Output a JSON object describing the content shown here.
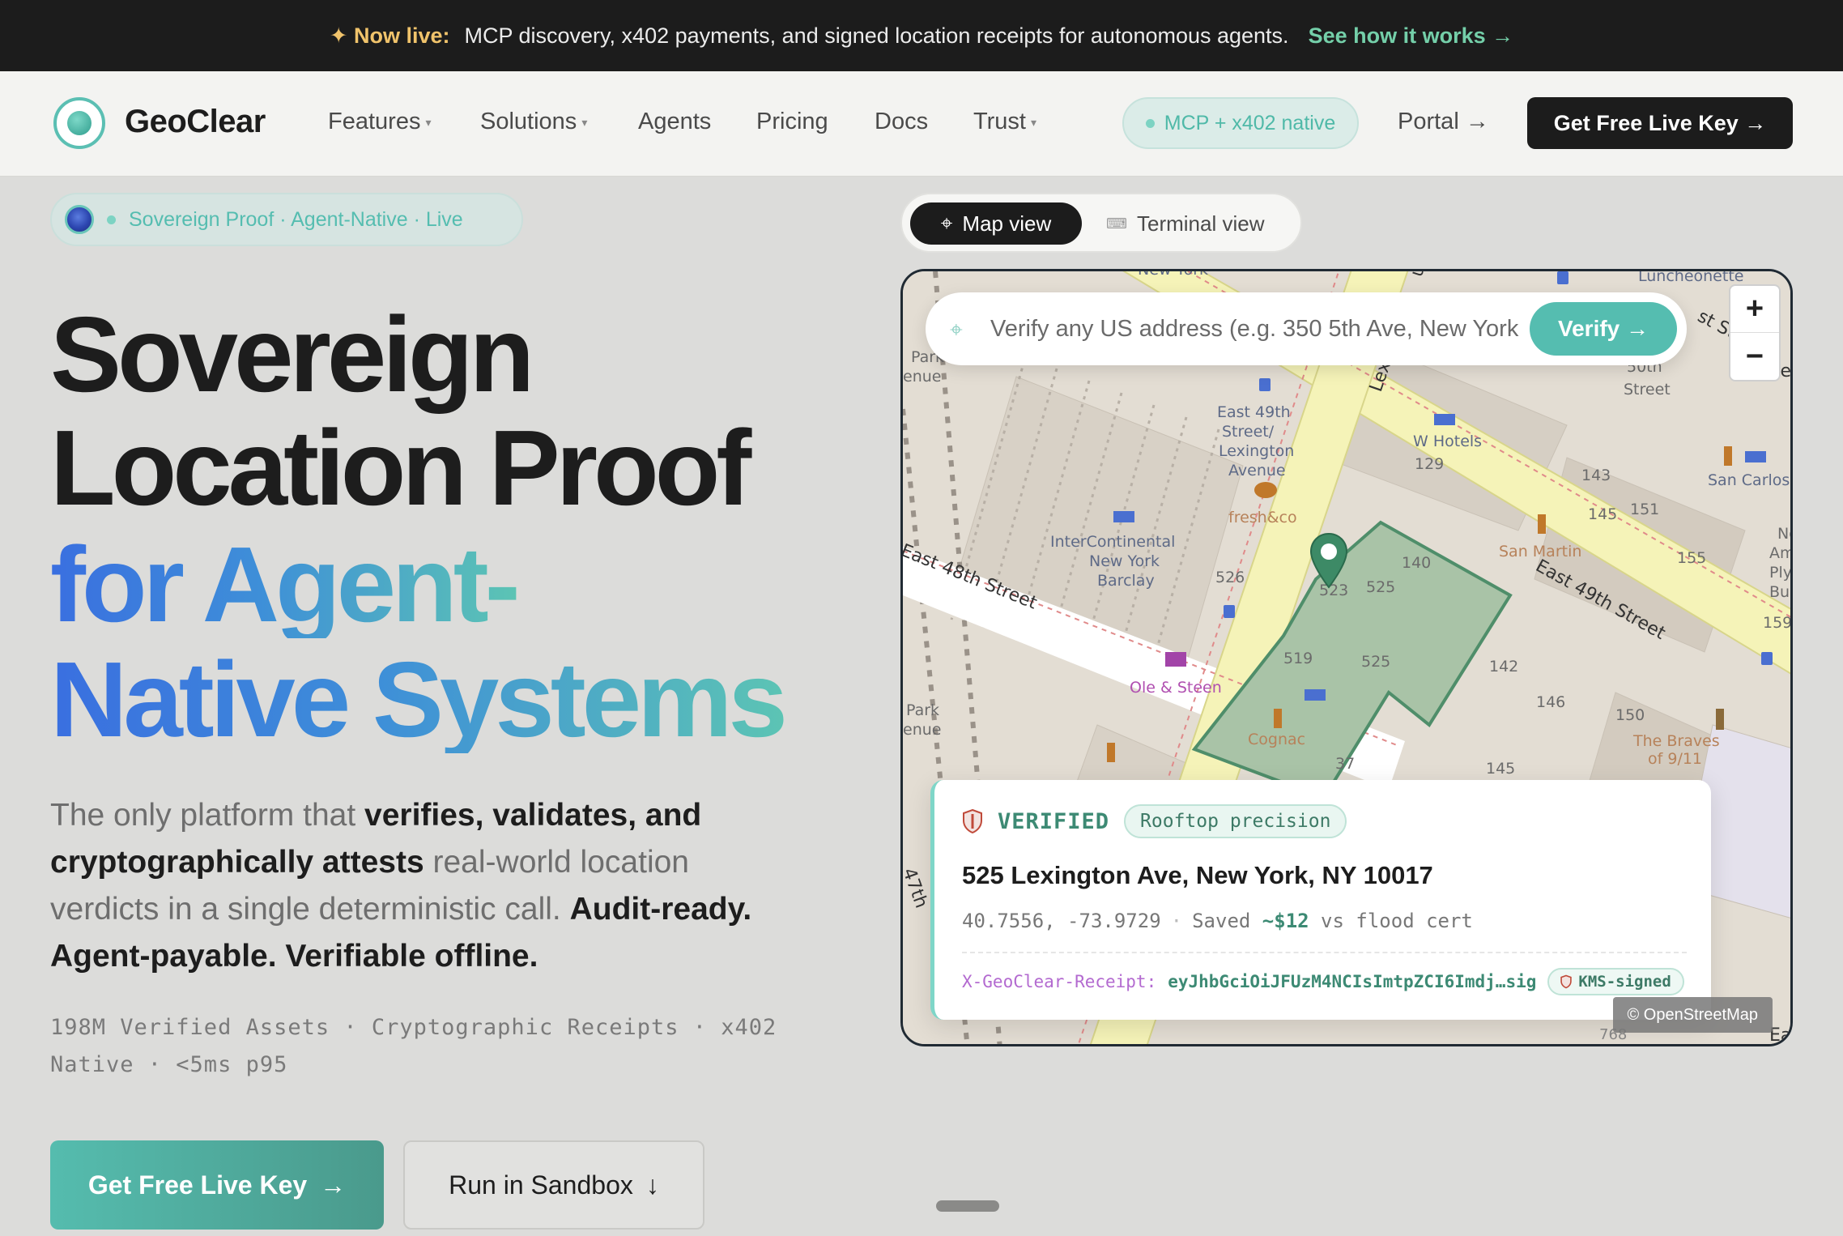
{
  "announcement": {
    "label": "✦ Now live:",
    "text": "MCP discovery, x402 payments, and signed location receipts for autonomous agents.",
    "link": "See how it works →"
  },
  "brand": {
    "name": "GeoClear",
    "accent": "#55bdb0",
    "dark": "#1c1c1c"
  },
  "nav": {
    "items": [
      {
        "label": "Features",
        "dropdown": true
      },
      {
        "label": "Solutions",
        "dropdown": true
      },
      {
        "label": "Agents",
        "dropdown": false
      },
      {
        "label": "Pricing",
        "dropdown": false
      },
      {
        "label": "Docs",
        "dropdown": false
      },
      {
        "label": "Trust",
        "dropdown": true
      }
    ],
    "caret": "▾",
    "native_pill": "MCP + x402 native",
    "portal": "Portal →",
    "cta": "Get Free Live Key →"
  },
  "hero": {
    "badge": "Sovereign Proof · Agent-Native · Live",
    "title_line1": "Sovereign",
    "title_line2": "Location Proof",
    "title_line3": "for Agent-",
    "title_line4": "Native Systems",
    "lead": {
      "p1": "The only platform that ",
      "b1": "verifies, validates, and cryptographically attests",
      "p2": " real-world location verdicts in a single deterministic call. ",
      "b2": "Audit-ready. Agent-payable. Verifiable offline."
    },
    "stats": "198M Verified Assets · Cryptographic Receipts · x402 Native · <5ms p95",
    "cta_primary": "Get Free Live Key",
    "cta_primary_arrow": "→",
    "cta_secondary": "Run in Sandbox",
    "cta_secondary_arrow": "↓"
  },
  "view_toggle": {
    "map_label": "Map view",
    "map_icon": "⌖",
    "terminal_label": "Terminal view",
    "terminal_icon": "⌨"
  },
  "map": {
    "search_placeholder": "Verify any US address (e.g. 350 5th Ave, New York",
    "search_icon": "⌖",
    "verify_label": "Verify →",
    "zoom_in": "+",
    "zoom_out": "−",
    "attribution": "© OpenStreetMap",
    "labels": {
      "new_york": "New York",
      "luncheonette": "Luncheonette",
      "park_1a": "Park",
      "park_1b": "enue",
      "park_2a": "Park",
      "park_2b": "enue",
      "lexington": "Lexin",
      "st_50_a": "50th",
      "st_50_b": "Street",
      "east_49_a": "East 49th",
      "east_49_b": "Street/",
      "east_49_c": "Lexington",
      "east_49_d": "Avenue",
      "w_hotels": "W Hotels",
      "n129": "129",
      "n143": "143",
      "n145a": "145",
      "n151": "151",
      "san_carlos": "San Carlos",
      "fresh": "fresh&co",
      "interconti_a": "InterContinental",
      "interconti_b": "New York",
      "interconti_c": "Barclay",
      "n140": "140",
      "san_martin": "San Martin",
      "n155": "155",
      "n159": "159",
      "no_a": "No",
      "no_b": "Amer",
      "no_c": "Plyw",
      "no_d": "Build",
      "n526": "526",
      "n523": "523",
      "n525a": "525",
      "n525b": "525",
      "east_49th_street": "East 49th Street",
      "east_48th_street": "East 48th Street",
      "n519": "519",
      "n142": "142",
      "ole": "Ole & Steen",
      "n146": "146",
      "n150": "150",
      "braves_a": "The Braves",
      "braves_b": "of 9/11",
      "cognac": "Cognac",
      "n145b": "145",
      "n37": "37",
      "n47": "47th",
      "n768": "768",
      "ea": "Ea",
      "st_short": "st St",
      "ue": "ue",
      "ee": "ee"
    }
  },
  "card": {
    "status": "VERIFIED",
    "precision": "Rooftop precision",
    "address": "525 Lexington Ave, New York, NY 10017",
    "coords": "40.7556, -73.9729",
    "sep": "·",
    "saved_prefix": "Saved ",
    "saved_value": "~$12",
    "saved_suffix": " vs flood cert",
    "receipt_key": "X-GeoClear-Receipt:",
    "receipt_value": "eyJhbGciOiJFUzM4NCIsImtpZCI6Imdj…sig",
    "kms": "KMS-signed"
  }
}
